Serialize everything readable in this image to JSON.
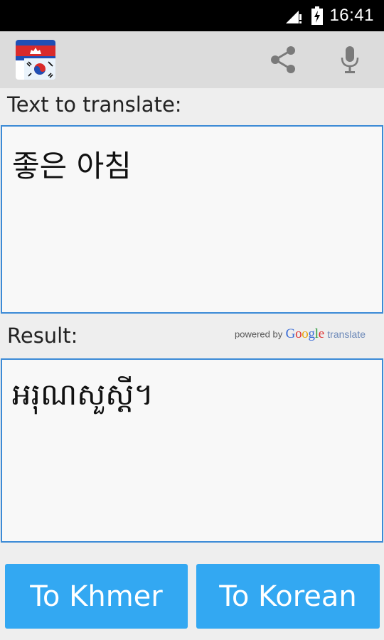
{
  "status_bar": {
    "time": "16:41",
    "icons": [
      "signal-icon",
      "battery-charging-icon"
    ]
  },
  "action_bar": {
    "icons": [
      "app-logo-cambodia-korea-flags",
      "share-icon",
      "microphone-icon"
    ]
  },
  "source": {
    "label": "Text to translate:",
    "text": "좋은 아침"
  },
  "result": {
    "label": "Result:",
    "text": "អរុណសួស្តី។"
  },
  "attribution": {
    "powered_by": "powered by",
    "google": "Google",
    "translate": "translate"
  },
  "buttons": {
    "to_khmer": "To Khmer",
    "to_korean": "To Korean"
  },
  "colors": {
    "accent": "#33a8f2",
    "border": "#3b8ad6",
    "action_bar": "#dcdcdc",
    "background": "#eeeeee"
  }
}
